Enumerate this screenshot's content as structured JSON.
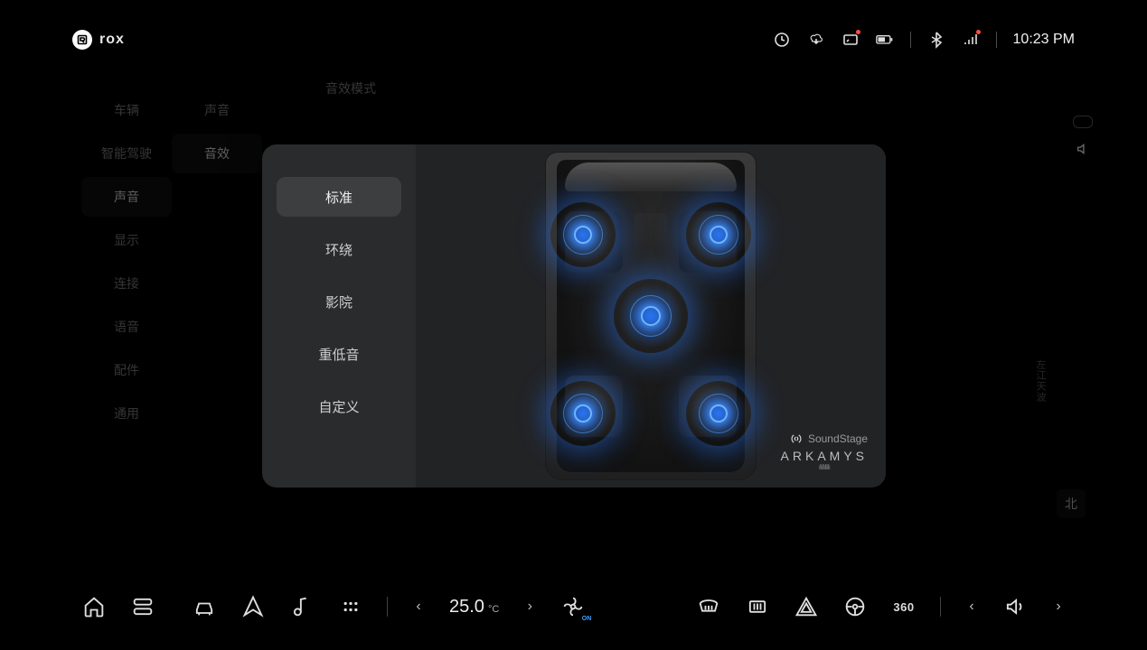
{
  "brand": "rox",
  "status": {
    "time": "10:23 PM"
  },
  "bg": {
    "setting_header": "音效模式",
    "col1": [
      "车辆",
      "智能驾驶",
      "声音",
      "显示",
      "连接",
      "语音",
      "配件",
      "通用"
    ],
    "col1_active": 2,
    "col2": [
      "声音",
      "音效"
    ],
    "col2_active": 1,
    "north": "北",
    "side_label": "左江天波"
  },
  "modal": {
    "modes": [
      "标准",
      "环绕",
      "影院",
      "重低音",
      "自定义"
    ],
    "active": 0,
    "soundstage": "SoundStage",
    "arkamys": "ARKAMYS"
  },
  "dock": {
    "temp_value": "25.0",
    "temp_unit": "°C",
    "label_360": "360",
    "fan_on": "ON"
  }
}
